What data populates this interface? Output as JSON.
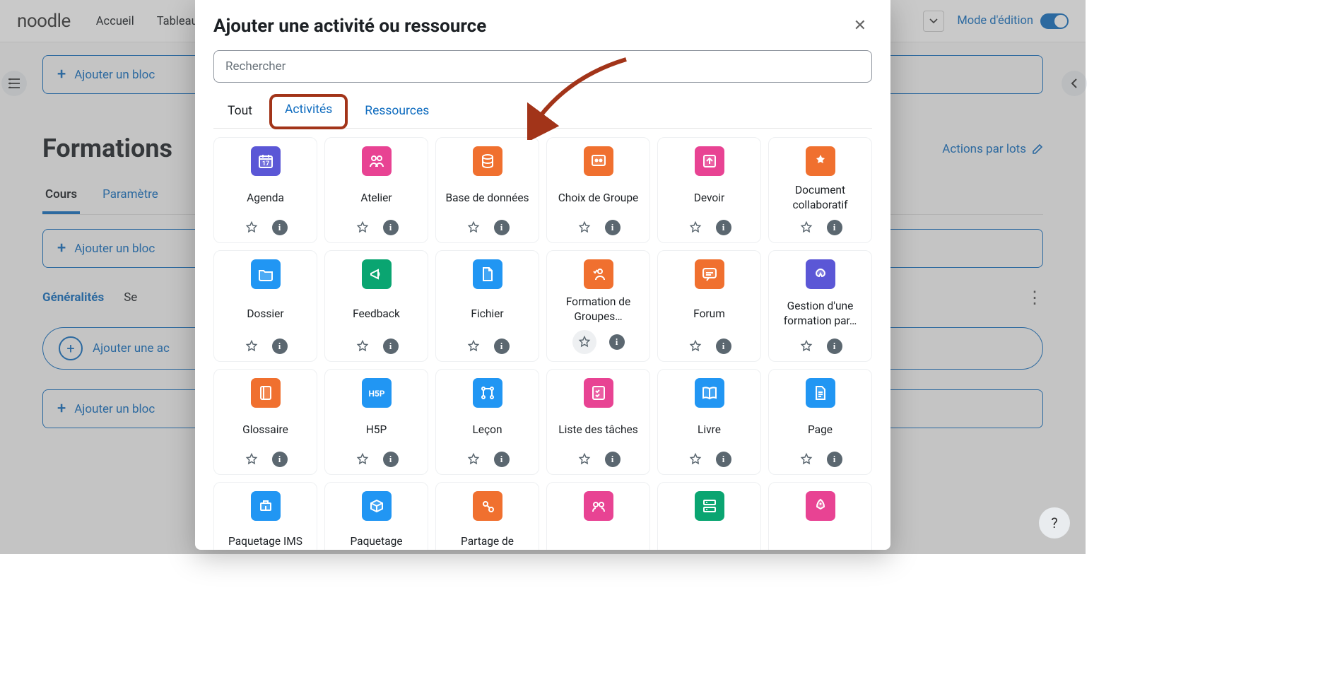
{
  "topbar": {
    "brand": "noodle",
    "nav": {
      "home": "Accueil",
      "dashboard": "Tableau"
    },
    "edit_mode_label": "Mode d'édition"
  },
  "page": {
    "add_block": "Ajouter un bloc",
    "course_title": "Formations",
    "batch_actions": "Actions par lots",
    "tabs": {
      "course": "Cours",
      "settings": "Paramètre"
    },
    "sections": {
      "general": "Généralités",
      "next": "Se"
    },
    "add_activity": "Ajouter une ac"
  },
  "modal": {
    "title": "Ajouter une activité ou ressource",
    "search_placeholder": "Rechercher",
    "tabs": {
      "all": "Tout",
      "activities": "Activités",
      "resources": "Ressources"
    },
    "items": [
      {
        "label": "Agenda",
        "color": "indigo",
        "glyph": "calendar"
      },
      {
        "label": "Atelier",
        "color": "pink",
        "glyph": "people"
      },
      {
        "label": "Base de données",
        "color": "orange",
        "glyph": "database"
      },
      {
        "label": "Choix de Groupe",
        "color": "orange",
        "glyph": "groupchoice"
      },
      {
        "label": "Devoir",
        "color": "pink",
        "glyph": "upload"
      },
      {
        "label": "Document collaboratif",
        "color": "orange",
        "glyph": "collab"
      },
      {
        "label": "Dossier",
        "color": "blue",
        "glyph": "folder"
      },
      {
        "label": "Feedback",
        "color": "green",
        "glyph": "megaphone"
      },
      {
        "label": "Fichier",
        "color": "blue",
        "glyph": "file"
      },
      {
        "label": "Formation de Groupes…",
        "color": "orange",
        "glyph": "groupform",
        "star_halo": true
      },
      {
        "label": "Forum",
        "color": "orange",
        "glyph": "chat"
      },
      {
        "label": "Gestion d'une formation par…",
        "color": "indigo",
        "glyph": "butterfly"
      },
      {
        "label": "Glossaire",
        "color": "orange",
        "glyph": "book"
      },
      {
        "label": "H5P",
        "color": "blue",
        "glyph": "h5p"
      },
      {
        "label": "Leçon",
        "color": "blue",
        "glyph": "path"
      },
      {
        "label": "Liste des tâches",
        "color": "pink",
        "glyph": "checklist"
      },
      {
        "label": "Livre",
        "color": "blue",
        "glyph": "openbook"
      },
      {
        "label": "Page",
        "color": "blue",
        "glyph": "page"
      }
    ],
    "peek_items": [
      {
        "label": "Paquetage IMS",
        "color": "blue",
        "glyph": "ims"
      },
      {
        "label": "Paquetage",
        "color": "blue",
        "glyph": "package"
      },
      {
        "label": "Partage de",
        "color": "orange",
        "glyph": "share"
      },
      {
        "label": "",
        "color": "pink",
        "glyph": "team"
      },
      {
        "label": "",
        "color": "green",
        "glyph": "server"
      },
      {
        "label": "",
        "color": "pink",
        "glyph": "rocket"
      }
    ]
  }
}
